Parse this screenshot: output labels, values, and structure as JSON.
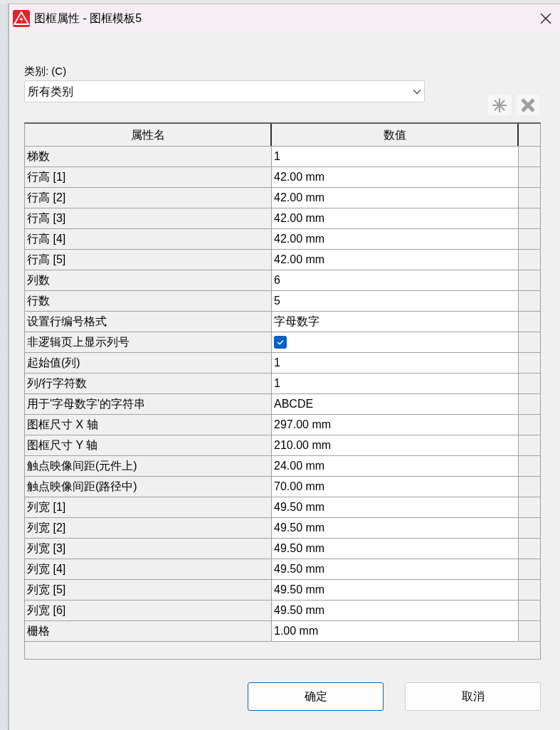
{
  "window": {
    "title": "图框属性 - 图框模板5"
  },
  "category": {
    "label": "类别: (C)",
    "value": "所有类别"
  },
  "toolbar": [
    {
      "kind": "new"
    },
    {
      "kind": "delete"
    }
  ],
  "table": {
    "columns": [
      "属性名",
      "数值"
    ],
    "rows": [
      {
        "name": "梯数",
        "kind": "text",
        "value": "1"
      },
      {
        "name": "行高 [1]",
        "kind": "text",
        "value": "42.00 mm"
      },
      {
        "name": "行高 [2]",
        "kind": "text",
        "value": "42.00 mm"
      },
      {
        "name": "行高 [3]",
        "kind": "text",
        "value": "42.00 mm"
      },
      {
        "name": "行高 [4]",
        "kind": "text",
        "value": "42.00 mm"
      },
      {
        "name": "行高 [5]",
        "kind": "text",
        "value": "42.00 mm"
      },
      {
        "name": "列数",
        "kind": "text",
        "value": "6"
      },
      {
        "name": "行数",
        "kind": "text",
        "value": "5"
      },
      {
        "name": "设置行编号格式",
        "kind": "text",
        "value": "字母数字"
      },
      {
        "name": "非逻辑页上显示列号",
        "kind": "checkbox",
        "checked": true
      },
      {
        "name": "起始值(列)",
        "kind": "text",
        "value": "1"
      },
      {
        "name": "列/行字符数",
        "kind": "text",
        "value": "1"
      },
      {
        "name": "用于'字母数字'的字符串",
        "kind": "text",
        "value": "ABCDE"
      },
      {
        "name": "图框尺寸 X 轴",
        "kind": "text",
        "value": "297.00 mm"
      },
      {
        "name": "图框尺寸 Y 轴",
        "kind": "text",
        "value": "210.00 mm"
      },
      {
        "name": "触点映像间距(元件上)",
        "kind": "text",
        "value": "24.00 mm"
      },
      {
        "name": "触点映像间距(路径中)",
        "kind": "text",
        "value": "70.00 mm"
      },
      {
        "name": "列宽 [1]",
        "kind": "text",
        "value": "49.50 mm"
      },
      {
        "name": "列宽 [2]",
        "kind": "text",
        "value": "49.50 mm"
      },
      {
        "name": "列宽 [3]",
        "kind": "text",
        "value": "49.50 mm"
      },
      {
        "name": "列宽 [4]",
        "kind": "text",
        "value": "49.50 mm"
      },
      {
        "name": "列宽 [5]",
        "kind": "text",
        "value": "49.50 mm"
      },
      {
        "name": "列宽 [6]",
        "kind": "text",
        "value": "49.50 mm"
      },
      {
        "name": "栅格",
        "kind": "text",
        "value": "1.00 mm"
      }
    ]
  },
  "buttons": [
    {
      "label": "确定",
      "kind": "primary"
    },
    {
      "label": "取消",
      "kind": "secondary"
    }
  ]
}
